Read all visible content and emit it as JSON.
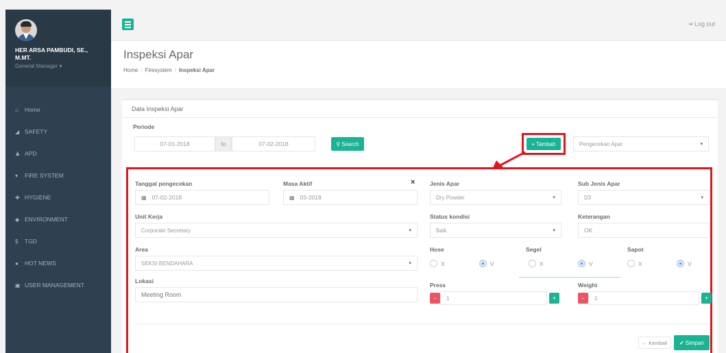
{
  "user": {
    "name": "HER ARSA PAMBUDI, SE., M.MT.",
    "role": "General Manager ▾"
  },
  "menu": [
    {
      "icon": "home-icon",
      "glyph": "⌂",
      "label": "Home"
    },
    {
      "icon": "thumbs-up-icon",
      "glyph": "◢",
      "label": "SAFETY"
    },
    {
      "icon": "user-icon",
      "glyph": "♟",
      "label": "APD"
    },
    {
      "icon": "fire-extinguisher-icon",
      "glyph": "▾",
      "label": "FIRE SYSTEM"
    },
    {
      "icon": "medkit-icon",
      "glyph": "✚",
      "label": "HYGIENE"
    },
    {
      "icon": "shield-icon",
      "glyph": "◆",
      "label": "ENVIRONMENT"
    },
    {
      "icon": "money-icon",
      "glyph": "$",
      "label": "TGD"
    },
    {
      "icon": "globe-icon",
      "glyph": "●",
      "label": "HOT NEWS"
    },
    {
      "icon": "lock-icon",
      "glyph": "▣",
      "label": "USER MANAGEMENT"
    }
  ],
  "topbar": {
    "logout": "⇥ Log out"
  },
  "heading": {
    "title": "Inspeksi Apar",
    "crumb1": "Home",
    "crumb2": "Firesystem",
    "crumb3": "Inspeksi Apar",
    "sep": "/"
  },
  "panel": {
    "title": "Data Inspeksi Apar",
    "periode_label": "Periode",
    "date_from": "07-01-2018",
    "to_label": "to",
    "date_to": "07-02-2018",
    "search_label": "Search",
    "tambah_label": "Tambah",
    "filter_select": "Pengecekan Apar"
  },
  "form": {
    "tanggal_label": "Tanggal pengecekan",
    "tanggal_value": "07-02-2018",
    "masa_label": "Masa Aktif",
    "masa_value": "03-2018",
    "close": "×",
    "jenis_label": "Jenis Apar",
    "jenis_value": "Dry Powder",
    "subjenis_label": "Sub Jenis Apar",
    "subjenis_value": "D3",
    "unit_label": "Unit Kerja",
    "unit_value": "Corporate Secretary",
    "status_label": "Status kondisi",
    "status_value": "Baik",
    "ket_label": "Keterangan",
    "ket_value": "OK",
    "area_label": "Area",
    "area_value": "SEKSI BENDAHARA",
    "hose_label": "Hose",
    "segel_label": "Segel",
    "sapot_label": "Sapot",
    "opt_x": "X",
    "opt_v": "V",
    "lokasi_label": "Lokasi",
    "lokasi_value": "Meeting Room",
    "press_label": "Press",
    "press_value": "1",
    "weight_label": "Weight",
    "weight_value": "1",
    "minus": "-",
    "plus": "+",
    "kembali_label": "Kembali",
    "simpan_label": "Simpan"
  },
  "colors": {
    "accent": "#1ab394",
    "sidebar": "#2f4050",
    "highlight": "#e0151f",
    "danger": "#ed5565"
  }
}
